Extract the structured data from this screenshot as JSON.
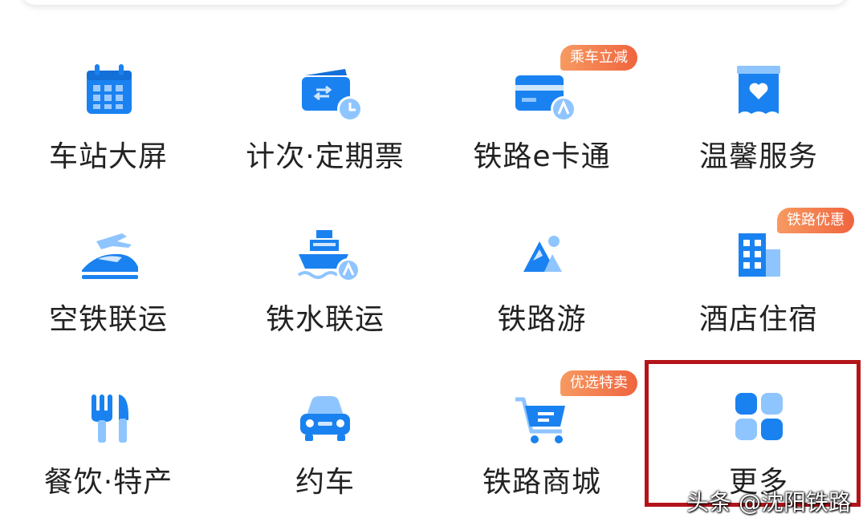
{
  "colors": {
    "primary": "#1a82f0",
    "light": "#8fc5ff",
    "badge": "#f0643e",
    "highlight": "#b3141a"
  },
  "tiles": [
    {
      "label": "车站大屏",
      "icon": "calendar-icon"
    },
    {
      "label": "计次·定期票",
      "icon": "ticket-clock-icon"
    },
    {
      "label": "铁路e卡通",
      "icon": "card-icon",
      "badge": "乘车立减"
    },
    {
      "label": "温馨服务",
      "icon": "heart-box-icon"
    },
    {
      "label": "空铁联运",
      "icon": "plane-train-icon"
    },
    {
      "label": "铁水联运",
      "icon": "ship-icon"
    },
    {
      "label": "铁路游",
      "icon": "mountain-icon"
    },
    {
      "label": "酒店住宿",
      "icon": "hotel-icon",
      "badge": "铁路优惠"
    },
    {
      "label": "餐饮·特产",
      "icon": "fork-knife-icon"
    },
    {
      "label": "约车",
      "icon": "car-icon"
    },
    {
      "label": "铁路商城",
      "icon": "cart-icon",
      "badge": "优选特卖"
    },
    {
      "label": "更多",
      "icon": "grid-more-icon"
    }
  ],
  "watermark": "头条 @沈阳铁路"
}
